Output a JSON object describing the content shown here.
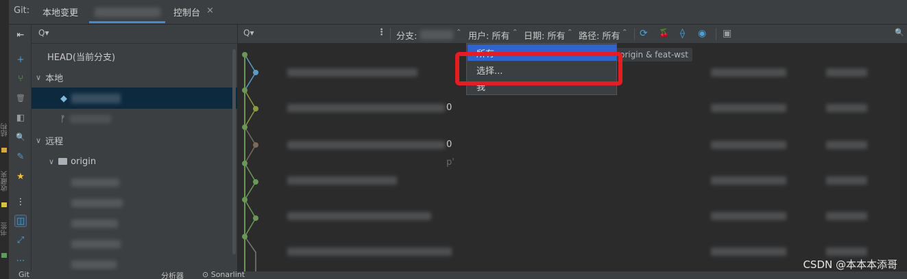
{
  "tabs": {
    "prefix": "Git:",
    "local_changes": "本地变更",
    "console": "控制台",
    "close_glyph": "×"
  },
  "edge": {
    "label_1": "结构",
    "label_2": "收藏夹",
    "label_3": "书签"
  },
  "vtoolbar": {
    "collapse": "⇤",
    "add": "+",
    "branch": "⑂",
    "delete": "🗑",
    "compare": "◧",
    "search": "🔍",
    "edit": "✎",
    "star": "★",
    "more_vert": "⋮",
    "group": "◫",
    "expand": "⤢",
    "more_horiz": "⋯"
  },
  "tree": {
    "search_glyph": "Q▾",
    "head": "HEAD(当前分支)",
    "local": "本地",
    "remote": "远程",
    "origin": "origin",
    "chevron": "∨",
    "tag_glyph": "◆",
    "branch_glyph": "ᚠ"
  },
  "log_toolbar": {
    "search_glyph": "Q▾",
    "more": "⋮",
    "branch_label": "分支:",
    "user_label": "用户: 所有",
    "date_label": "日期: 所有",
    "path_label": "路径: 所有",
    "arrow": "⌃",
    "refresh": "⟳",
    "cherry": "🍒",
    "graph": "⟠",
    "eye": "◉",
    "panel": "▣",
    "right_search": "🔍"
  },
  "dropdown": {
    "item_all": "所有",
    "item_select": "选择...",
    "item_me": "我"
  },
  "graph": {
    "digit_1": "0",
    "digit_2": "0",
    "digit_3": "p'"
  },
  "tag_pill": "origin & feat-wst",
  "watermark": "CSDN @本本本添哥",
  "bottom": {
    "git": "Git",
    "analyzer": "分析器",
    "todo": "⊙ Sonarlint"
  },
  "colors": {
    "accent": "#4a88c7",
    "selected": "#0d293e",
    "highlight": "#2f65ca",
    "redbox": "#e41d25",
    "graph_green": "#6a9955",
    "graph_blue": "#5b9bc6",
    "graph_olive": "#8a9a3a"
  }
}
